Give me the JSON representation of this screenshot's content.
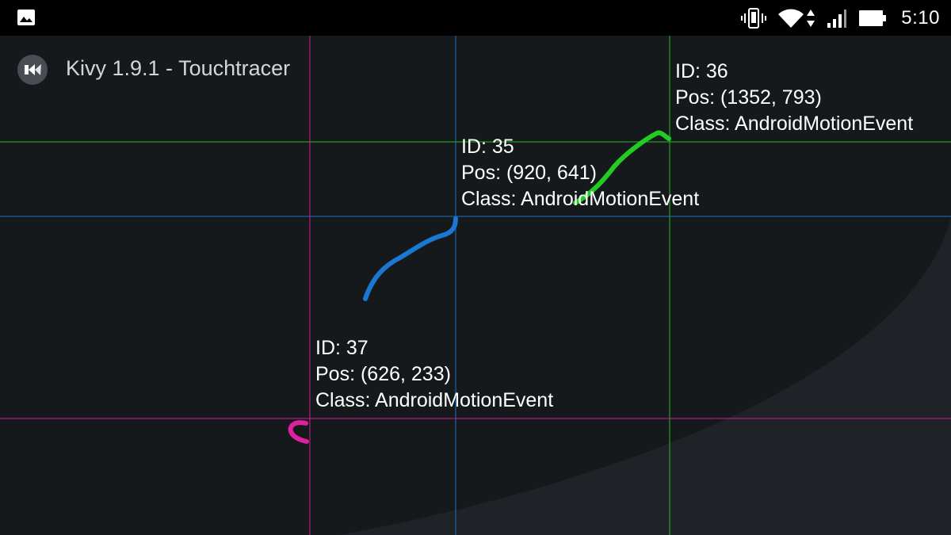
{
  "status_bar": {
    "time": "5:10",
    "icons": [
      "gallery-icon",
      "vibrate-icon",
      "wifi-icon",
      "data-arrows-icon",
      "cellular-signal-icon",
      "battery-icon"
    ]
  },
  "app": {
    "title": "Kivy 1.9.1 - Touchtracer",
    "logo_icon": "kivy-logo-icon",
    "background": "#16191c"
  },
  "touches": [
    {
      "id_label": "ID: 36",
      "pos_label": "Pos: (1352, 793)",
      "class_label": "Class: AndroidMotionEvent",
      "color": "#22cc22"
    },
    {
      "id_label": "ID: 35",
      "pos_label": "Pos: (920, 641)",
      "class_label": "Class: AndroidMotionEvent",
      "color": "#1a78d2"
    },
    {
      "id_label": "ID: 37",
      "pos_label": "Pos: (626, 233)",
      "class_label": "Class: AndroidMotionEvent",
      "color": "#e020a0"
    }
  ]
}
